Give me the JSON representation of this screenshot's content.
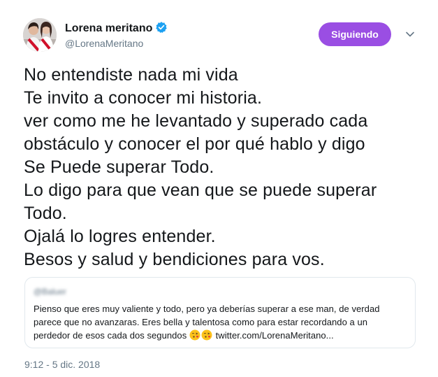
{
  "user": {
    "display_name": "Lorena meritano",
    "handle": "@LorenaMeritano",
    "verified": true
  },
  "follow_button": {
    "label": "Siguiendo",
    "color": "#9a4ee3"
  },
  "tweet": {
    "lines": [
      "No entendiste nada mi vida",
      "Te invito a conocer mi historia.",
      "ver como me he levantado y superado cada",
      "obstáculo y conocer el por qué hablo y digo",
      "Se Puede superar Todo.",
      "Lo digo para que vean que se puede superar",
      "Todo.",
      "Ojalá lo logres entender.",
      "Besos y salud y bendiciones para vos."
    ],
    "timestamp": "9:12 - 5 dic. 2018"
  },
  "quoted_tweet": {
    "author_blurred": "@Baluer",
    "line1": "Pienso que eres muy valiente y todo, pero ya deberías superar a ese man, de verdad",
    "line2": "parece que no avanzaras. Eres bella y talentosa como para estar recordando a un",
    "line3_text": "perdedor de esos cada dos segundos",
    "emojis": [
      "face-blowing-kiss-emoji",
      "face-blowing-kiss-emoji"
    ],
    "link": "twitter.com/LorenaMeritano..."
  },
  "icons": {
    "verified": "verified-badge-icon",
    "caret": "chevron-down-icon",
    "accent_verified": "#1da1f2"
  }
}
